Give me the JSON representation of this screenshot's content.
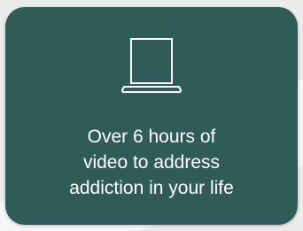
{
  "card": {
    "icon": "laptop-icon",
    "caption_lines": [
      "Over 6 hours of",
      "video to address",
      "addiction in your life"
    ]
  },
  "colors": {
    "card_background": "#2f5c59",
    "text": "#ffffff",
    "page_background": "#ebebeb"
  }
}
